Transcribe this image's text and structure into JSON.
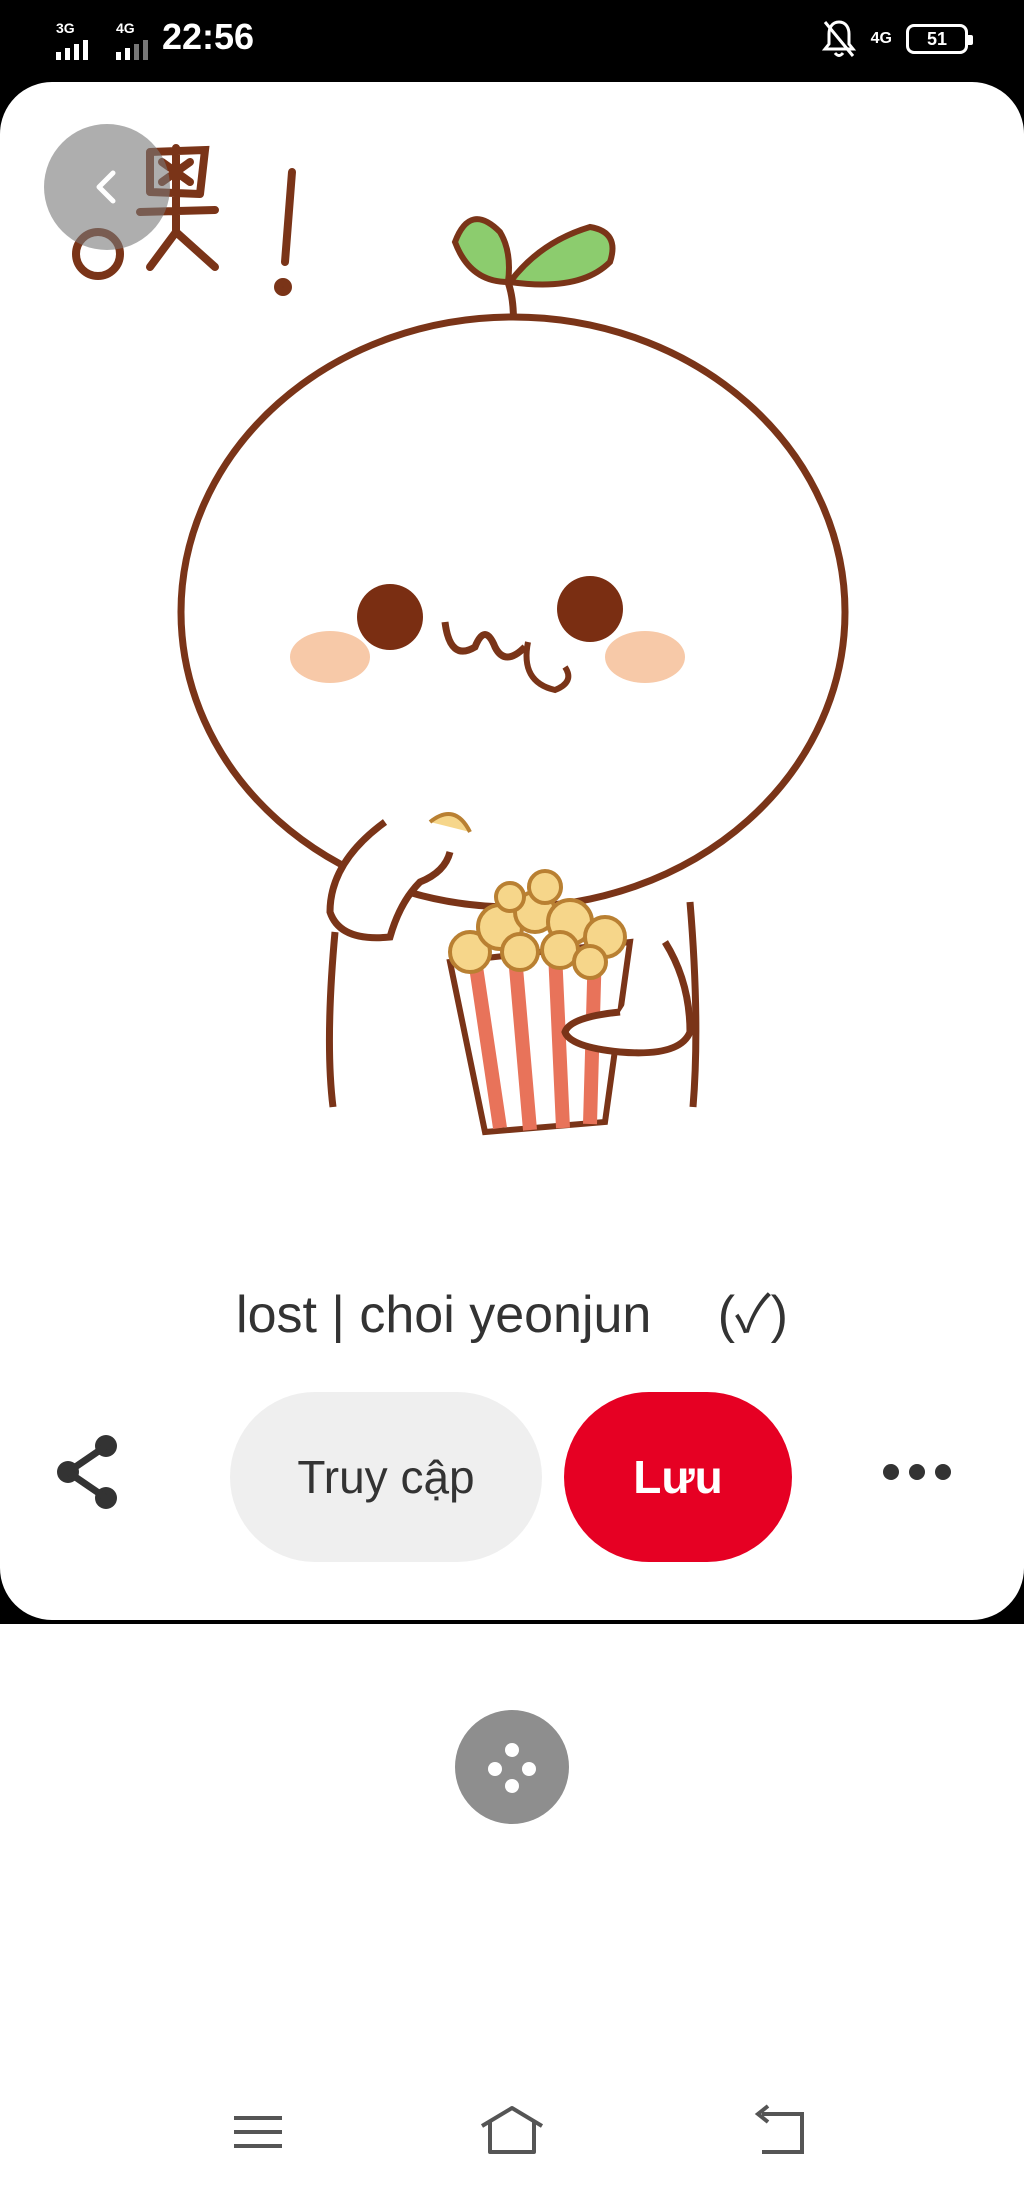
{
  "status_bar": {
    "signal_1": "3G",
    "signal_2": "4G",
    "time": "22:56",
    "network": "4G",
    "battery": "51"
  },
  "pin": {
    "title": "lost | choi yeonjun 　(✓)",
    "image_icon": "sprout-character-eating-popcorn-sticker",
    "sticker_text": "噢!"
  },
  "actions": {
    "share_icon": "share-icon",
    "visit_label": "Truy cập",
    "save_label": "Lưu",
    "more_icon": "more-icon"
  },
  "colors": {
    "save_button": "#e60023",
    "visit_button": "#efefef",
    "lens_button": "#8e8e8e"
  },
  "nav_bar": {
    "menu_icon": "menu-icon",
    "home_icon": "home-icon",
    "back_icon": "back-icon"
  }
}
